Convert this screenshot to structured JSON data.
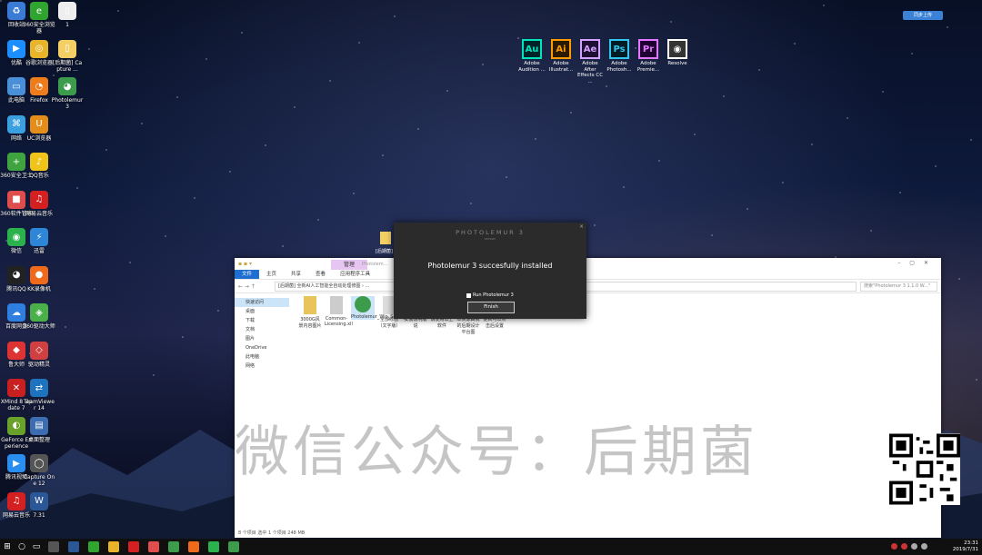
{
  "desktop": {
    "icons_left": [
      {
        "label": "回收站",
        "color": "#3a7bd5",
        "glyph": "♻"
      },
      {
        "label": "优酷",
        "color": "#1b8fff",
        "glyph": "▶"
      },
      {
        "label": "此电脑",
        "color": "#4a90d9",
        "glyph": "▭"
      },
      {
        "label": "网络",
        "color": "#3aa0e0",
        "glyph": "⌘"
      },
      {
        "label": "360安全卫士",
        "color": "#3fa33f",
        "glyph": "+"
      },
      {
        "label": "360软件管家",
        "color": "#e04d4d",
        "glyph": "■"
      },
      {
        "label": "微信",
        "color": "#2bb24c",
        "glyph": "◉"
      },
      {
        "label": "腾讯QQ",
        "color": "#222",
        "glyph": "◕"
      },
      {
        "label": "百度网盘",
        "color": "#2f7fe0",
        "glyph": "☁"
      },
      {
        "label": "鲁大师",
        "color": "#d33",
        "glyph": "◆"
      },
      {
        "label": "XMind 8 Update 7",
        "color": "#c82020",
        "glyph": "✕"
      },
      {
        "label": "GeForce Experience",
        "color": "#6aa12a",
        "glyph": "◐"
      },
      {
        "label": "腾讯视频",
        "color": "#2a8df0",
        "glyph": "▶"
      },
      {
        "label": "网易云音乐",
        "color": "#d42020",
        "glyph": "♫"
      }
    ],
    "icons_col2": [
      {
        "label": "360安全浏览器",
        "color": "#2fa52f",
        "glyph": "e"
      },
      {
        "label": "谷歌浏览器",
        "color": "#e8b52a",
        "glyph": "◎"
      },
      {
        "label": "Firefox",
        "color": "#ef7c1a",
        "glyph": "◔"
      },
      {
        "label": "UC浏览器",
        "color": "#e38e1a",
        "glyph": "U"
      },
      {
        "label": "QQ音乐",
        "color": "#f0c419",
        "glyph": "♪"
      },
      {
        "label": "网易云音乐",
        "color": "#d42020",
        "glyph": "♫"
      },
      {
        "label": "迅雷",
        "color": "#2e86d8",
        "glyph": "⚡"
      },
      {
        "label": "KK录像机",
        "color": "#ef6a1a",
        "glyph": "●"
      },
      {
        "label": "360驱动大师",
        "color": "#4ab04a",
        "glyph": "◈"
      },
      {
        "label": "驱动精灵",
        "color": "#d04040",
        "glyph": "◇"
      },
      {
        "label": "TeamViewer 14",
        "color": "#1e73be",
        "glyph": "⇄"
      },
      {
        "label": "桌面整理",
        "color": "#3c6db0",
        "glyph": "▤"
      },
      {
        "label": "Capture One 12",
        "color": "#555",
        "glyph": "◯"
      },
      {
        "label": "7.31",
        "color": "#2b5797",
        "glyph": "W"
      }
    ],
    "icons_col3": [
      {
        "label": "1",
        "color": "#eee",
        "glyph": "▯"
      },
      {
        "label": "[后期菌] Capture ...",
        "color": "#f3cf64",
        "glyph": "▯"
      },
      {
        "label": "Photolemur 3",
        "color": "#3c9c4c",
        "glyph": "◕"
      }
    ],
    "adobe_apps": [
      {
        "abbr": "Au",
        "label": "Adobe Audition ...",
        "color": "#00e4bb",
        "bg": "#00232a"
      },
      {
        "abbr": "Ai",
        "label": "Adobe Illustrat...",
        "color": "#ff9a00",
        "bg": "#2a1a00"
      },
      {
        "abbr": "Ae",
        "label": "Adobe After Effects CC ...",
        "color": "#d4a3ff",
        "bg": "#1e1033"
      },
      {
        "abbr": "Ps",
        "label": "Adobe Photosh...",
        "color": "#31c5f0",
        "bg": "#001d26"
      },
      {
        "abbr": "Pr",
        "label": "Adobe Premie...",
        "color": "#e477ff",
        "bg": "#200033"
      },
      {
        "abbr": "◉",
        "label": "Resolve",
        "color": "#fff",
        "bg": "#333"
      }
    ],
    "cloud_button": "同步上传",
    "folder_label": "[后期菌]"
  },
  "explorer": {
    "manage_tab": "管理",
    "title_path": "Photolem...",
    "ribbon": [
      "文件",
      "主页",
      "共享",
      "查看",
      "应用程序工具"
    ],
    "address": "[后期菌] 全新AI人工智能全自动处理修图 › ...",
    "search_placeholder": "搜索\"Photolemur 3 1.1.0 W...\"",
    "nav": [
      "快速访问",
      "桌面",
      "下载",
      "文档",
      "图片",
      "OneDrive",
      "此电脑",
      "网络"
    ],
    "files": [
      {
        "name": "3000G风景内容图片",
        "color": "#e8c45a"
      },
      {
        "name": "Common-Licensing.xll",
        "color": "#ccc"
      },
      {
        "name": "Photolemur_Win_Setup_2493",
        "color": "#3c9c4c"
      },
      {
        "name": "全部修图（文字版）",
        "color": "#ddd"
      },
      {
        "name": "安装说明版说",
        "color": "#ddd"
      },
      {
        "name": "请使用以上软件",
        "color": "#ddd"
      },
      {
        "name": "本资源由我的后期设计平台图",
        "color": "#ddd"
      },
      {
        "name": "更新可以点击后设置",
        "color": "#ddd"
      }
    ],
    "status": "8 个项目   选中 1 个项目 248 MB",
    "watermark": "微信公众号：后期菌"
  },
  "dialog": {
    "title": "PHOTOLEMUR 3",
    "subtitle": "version",
    "message": "Photolemur 3 succesfully installed",
    "run_label": "Run Photolemur 3",
    "finish_label": "Finish"
  },
  "taskbar": {
    "items": [
      "#555",
      "#2b5797",
      "#2fa52f",
      "#e8b52a",
      "#d42020",
      "#e04d4d",
      "#3c9c4c",
      "#ef6a1a",
      "#2bb24c",
      "#3c9c4c"
    ],
    "time": "23:31",
    "date": "2019/7/31"
  }
}
